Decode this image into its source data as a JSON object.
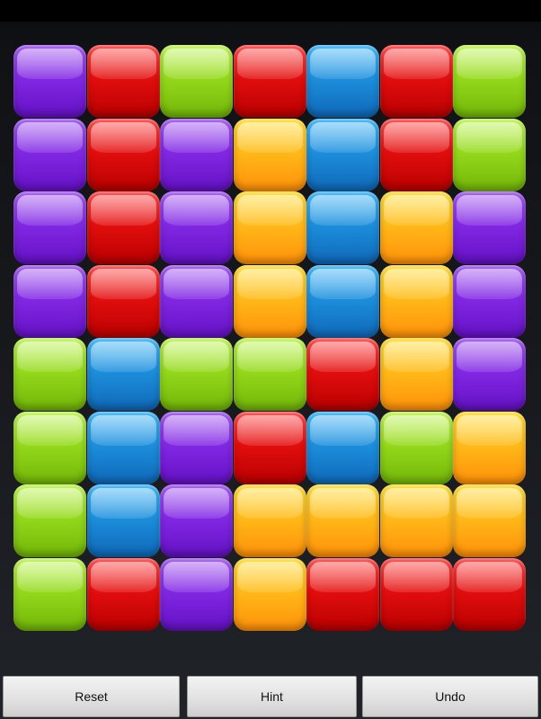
{
  "board": {
    "columns": 7,
    "rows": 8,
    "colors": {
      "purple": "#8228e4",
      "red": "#e30e0e",
      "green": "#95d91c",
      "blue": "#1d8fdc",
      "yellow": "#ffba18"
    },
    "grid": [
      [
        "purple",
        "red",
        "green",
        "red",
        "blue",
        "red",
        "green"
      ],
      [
        "purple",
        "red",
        "purple",
        "yellow",
        "blue",
        "red",
        "green"
      ],
      [
        "purple",
        "red",
        "purple",
        "yellow",
        "blue",
        "yellow",
        "purple"
      ],
      [
        "purple",
        "red",
        "purple",
        "yellow",
        "blue",
        "yellow",
        "purple"
      ],
      [
        "green",
        "blue",
        "green",
        "green",
        "red",
        "yellow",
        "purple"
      ],
      [
        "green",
        "blue",
        "purple",
        "red",
        "blue",
        "green",
        "yellow"
      ],
      [
        "green",
        "blue",
        "purple",
        "yellow",
        "yellow",
        "yellow",
        "yellow"
      ],
      [
        "green",
        "red",
        "purple",
        "yellow",
        "red",
        "red",
        "red"
      ]
    ]
  },
  "controls": {
    "reset_label": "Reset",
    "hint_label": "Hint",
    "undo_label": "Undo"
  }
}
